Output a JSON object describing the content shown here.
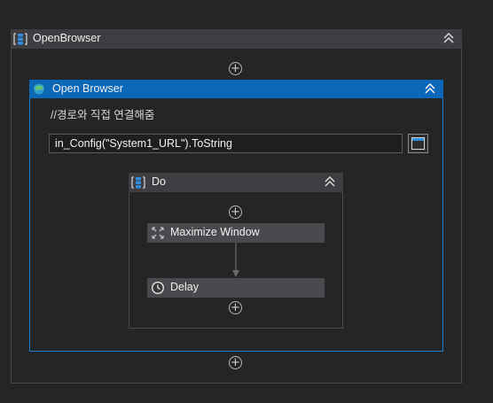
{
  "outer_sequence": {
    "title": "OpenBrowser"
  },
  "open_browser": {
    "title": "Open Browser",
    "comment": "//경로와 직접 연결해줌",
    "url_value": "in_Config(\"System1_URL\").ToString"
  },
  "do_sequence": {
    "title": "Do"
  },
  "activities": [
    {
      "label": "Maximize Window",
      "icon": "maximize-icon"
    },
    {
      "label": "Delay",
      "icon": "clock-icon"
    }
  ],
  "add_symbol": "+",
  "colors": {
    "accent": "#0b67b8",
    "header": "#3e3e42",
    "background": "#252526"
  }
}
